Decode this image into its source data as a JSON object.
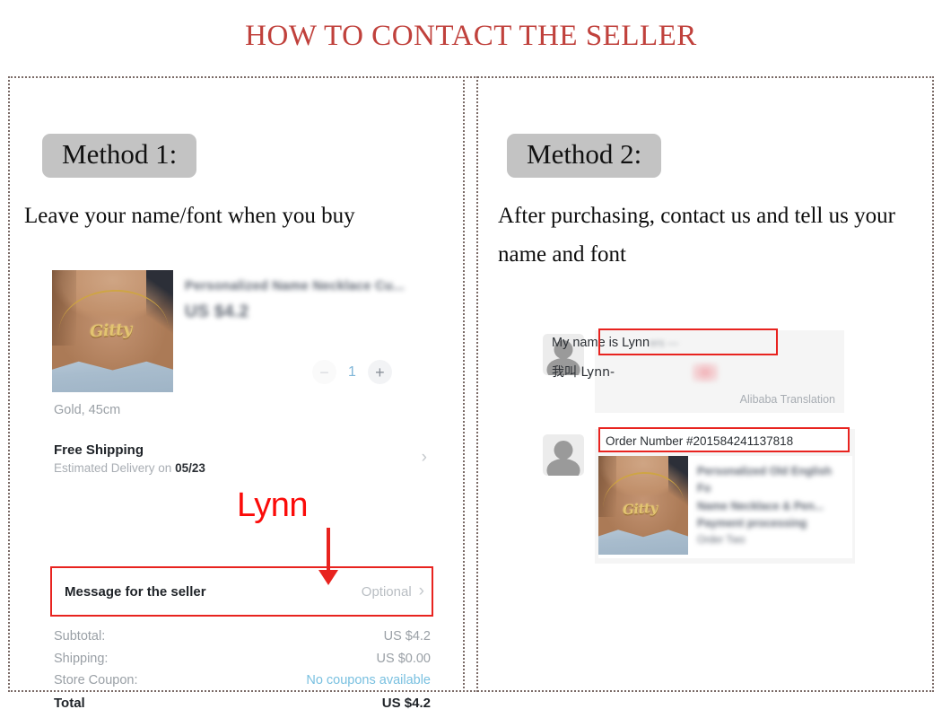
{
  "title": "HOW TO CONTACT THE SELLER",
  "methods": [
    {
      "badge": "Method 1:",
      "description": "Leave your name/font when you buy"
    },
    {
      "badge": "Method 2:",
      "description": "After purchasing, contact us and tell us your name and font"
    }
  ],
  "order_screenshot": {
    "product_title": "Personalized Name Necklace Cu...",
    "product_price": "US $4.2",
    "pendant_name": "Gitty",
    "quantity": {
      "decrease": "−",
      "value": "1",
      "increase": "+"
    },
    "variant": "Gold, 45cm",
    "shipping": {
      "title": "Free Shipping",
      "estimate_label": "Estimated Delivery on",
      "estimate_date": "05/23",
      "chevron": "›"
    },
    "message_row": {
      "label": "Message for the seller",
      "value": "Optional",
      "chevron": "›"
    },
    "totals": [
      {
        "label": "Subtotal:",
        "value": "US $4.2",
        "style": "normal"
      },
      {
        "label": "Shipping:",
        "value": "US $0.00",
        "style": "normal"
      },
      {
        "label": "Store Coupon:",
        "value": "No coupons available",
        "style": "coupon"
      },
      {
        "label": "Total",
        "value": "US $4.2",
        "style": "final"
      }
    ],
    "annotation": {
      "name": "Lynn",
      "arrow": "down-arrow"
    }
  },
  "chat_screenshot": {
    "message_1": {
      "text": "My name is Lynn",
      "blurred_tail": "ers —",
      "translation": "我叫 Lynn-",
      "translation_note": "Alibaba Translation"
    },
    "message_2": {
      "order_number": "Order Number #201584241137818",
      "card": {
        "pendant_name": "Gitty",
        "line_1": "Personalized Old English Fo",
        "line_2": "Name Necklace & Pen...",
        "line_3": "Payment processing",
        "line_4": "Order Two"
      }
    }
  },
  "colors": {
    "title_red": "#c0413c",
    "annotation_red": "#e8231f",
    "badge_gray": "#c3c3c3",
    "coupon_blue": "#79c0e0",
    "frame_dotted": "#7a6a66"
  }
}
